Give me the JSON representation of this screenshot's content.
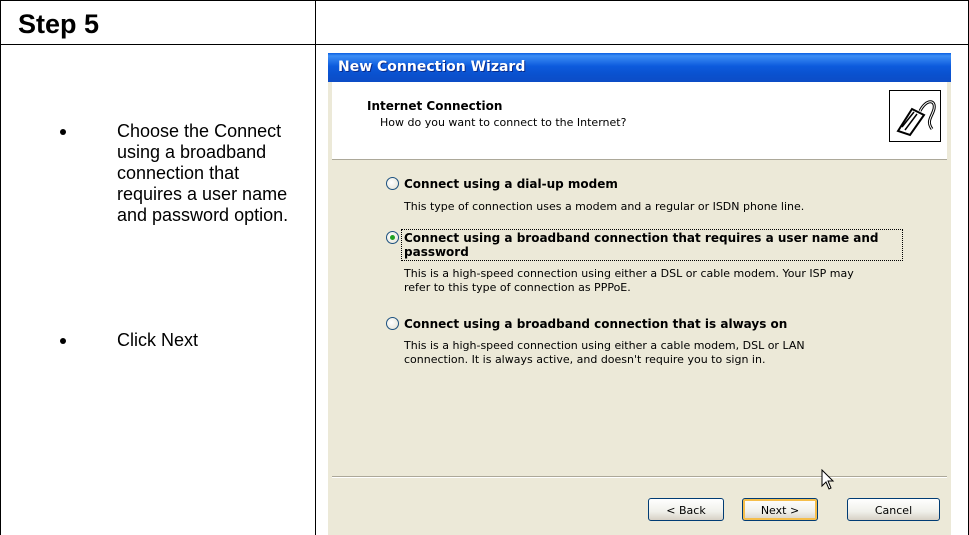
{
  "step": {
    "title": "Step 5"
  },
  "instructions": [
    {
      "text": "Choose the Connect using a broadband connection that requires a user name and password option."
    },
    {
      "text": "Click Next"
    }
  ],
  "wizard": {
    "window_title": "New Connection Wizard",
    "header_title": "Internet Connection",
    "header_subtitle": "How do you want to connect to the Internet?",
    "header_icon": "network-cable-icon",
    "options": [
      {
        "label": "Connect using a dial-up modem",
        "description": "This type of connection uses a modem and a regular or ISDN phone line.",
        "selected": false
      },
      {
        "label_line1": "Connect using a broadband connection that requires a user name and",
        "label_line2": "password",
        "description_line1": "This is a high-speed connection using either a DSL or cable modem. Your ISP may",
        "description_line2": "refer to this type of connection as PPPoE.",
        "selected": true
      },
      {
        "label": "Connect using a broadband connection that is always on",
        "description_line1": "This is a high-speed connection using either a cable modem, DSL or LAN",
        "description_line2": "connection. It is always active, and doesn't require you to sign in.",
        "selected": false
      }
    ],
    "buttons": {
      "back": "< Back",
      "next": "Next >",
      "cancel": "Cancel"
    }
  },
  "colors": {
    "titlebar": "#0A52D0",
    "dialog_bg": "#ECE9D8",
    "radio_selected": "#21A121"
  }
}
